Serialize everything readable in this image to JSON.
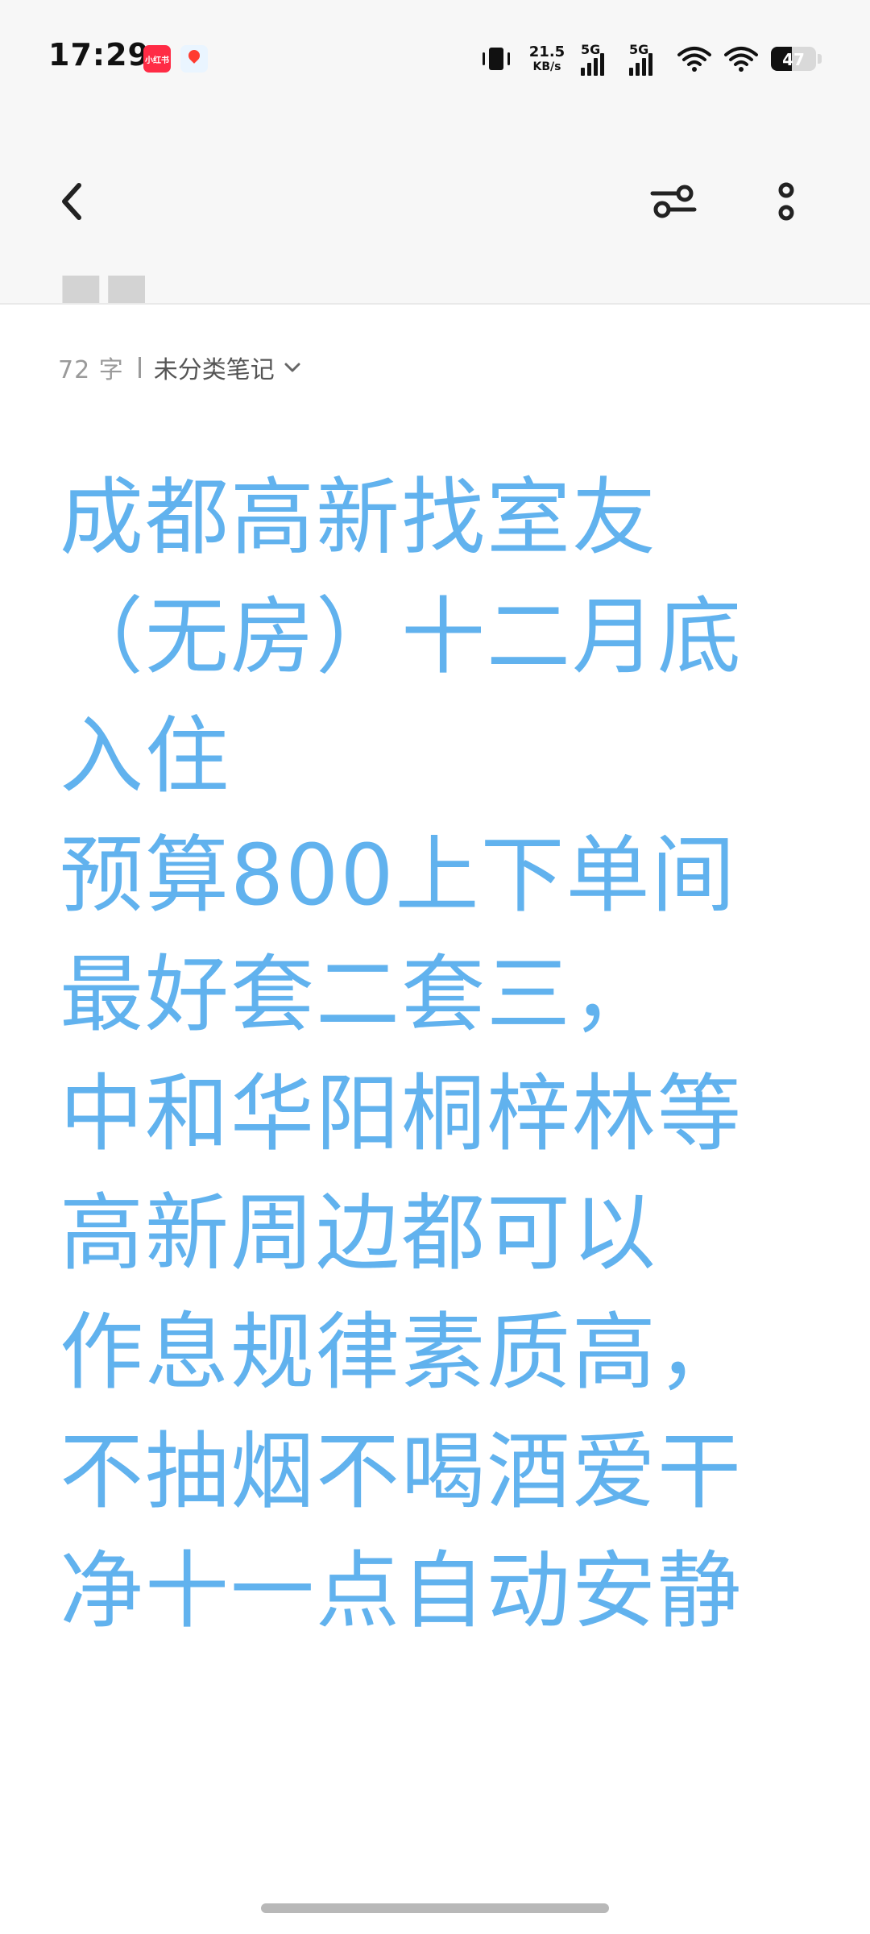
{
  "status_bar": {
    "time": "17:29",
    "apps": [
      {
        "name": "xiaohongshu-app-icon",
        "label": "小红书",
        "color": "#ff2b45"
      },
      {
        "name": "map-app-icon",
        "color": "#ff3b30"
      }
    ],
    "network_speed": {
      "value": "21.5",
      "unit": "KB/s"
    },
    "signal_1": "5G",
    "signal_2": "5G",
    "battery": {
      "level": 47,
      "text": "47"
    }
  },
  "toolbar": {
    "icons": [
      "back-icon",
      "adjust-icon",
      "more-vertical-icon"
    ]
  },
  "note": {
    "word_count": "72 字",
    "category": "未分类笔记",
    "lines": [
      "成都高新找室友",
      "（无房）十二月底",
      "入住",
      "预算800上下单间",
      "最好套二套三，",
      "中和华阳桐梓林等",
      "高新周边都可以",
      "作息规律素质高，",
      "不抽烟不喝酒爱干",
      "净十一点自动安静"
    ],
    "text_color": "#61b2ee"
  }
}
